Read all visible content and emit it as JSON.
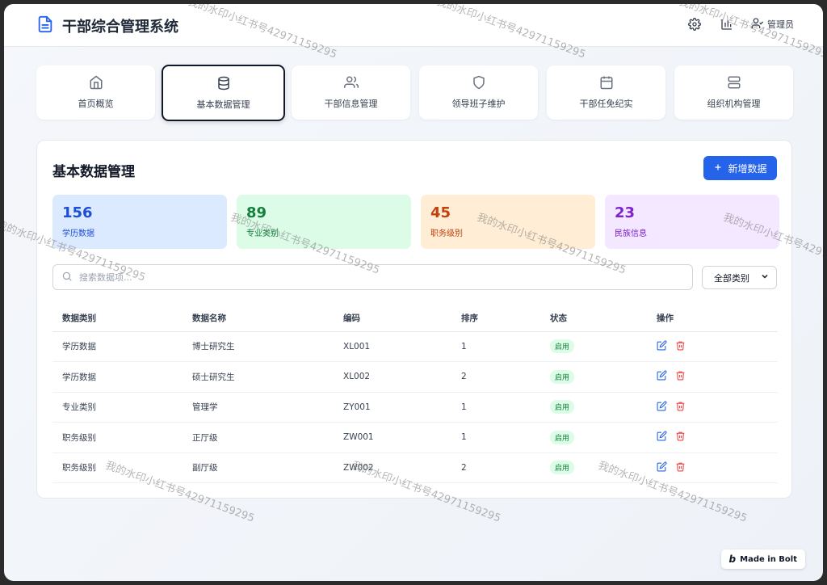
{
  "app": {
    "title": "干部综合管理系统"
  },
  "header": {
    "user_label": "管理员"
  },
  "nav": [
    {
      "label": "首页概览",
      "icon": "home-icon",
      "active": false
    },
    {
      "label": "基本数据管理",
      "icon": "database-icon",
      "active": true
    },
    {
      "label": "干部信息管理",
      "icon": "users-icon",
      "active": false
    },
    {
      "label": "领导班子维护",
      "icon": "shield-icon",
      "active": false
    },
    {
      "label": "干部任免纪实",
      "icon": "calendar-icon",
      "active": false
    },
    {
      "label": "组织机构管理",
      "icon": "server-icon",
      "active": false
    }
  ],
  "panel": {
    "title": "基本数据管理",
    "add_label": "新增数据"
  },
  "stats": [
    {
      "value": "156",
      "label": "学历数据",
      "bg": "#dbeafe",
      "color": "#1d4ed8"
    },
    {
      "value": "89",
      "label": "专业类别",
      "bg": "#dcfce7",
      "color": "#15803d"
    },
    {
      "value": "45",
      "label": "职务级别",
      "bg": "#ffedd5",
      "color": "#c2410c"
    },
    {
      "value": "23",
      "label": "民族信息",
      "bg": "#f3e8ff",
      "color": "#7e22ce"
    }
  ],
  "search": {
    "placeholder": "搜索数据项..."
  },
  "filter": {
    "selected": "全部类别"
  },
  "table": {
    "headers": [
      "数据类别",
      "数据名称",
      "编码",
      "排序",
      "状态",
      "操作"
    ],
    "rows": [
      {
        "category": "学历数据",
        "name": "博士研究生",
        "code": "XL001",
        "order": "1",
        "status": "启用"
      },
      {
        "category": "学历数据",
        "name": "硕士研究生",
        "code": "XL002",
        "order": "2",
        "status": "启用"
      },
      {
        "category": "专业类别",
        "name": "管理学",
        "code": "ZY001",
        "order": "1",
        "status": "启用"
      },
      {
        "category": "职务级别",
        "name": "正厅级",
        "code": "ZW001",
        "order": "1",
        "status": "启用"
      },
      {
        "category": "职务级别",
        "name": "副厅级",
        "code": "ZW002",
        "order": "2",
        "status": "启用"
      }
    ]
  },
  "badge": {
    "made_in": "Made in Bolt"
  },
  "watermark": {
    "text": "我的水印小红书号42971159295"
  },
  "colors": {
    "accent": "#2563eb",
    "danger": "#ef4444"
  }
}
